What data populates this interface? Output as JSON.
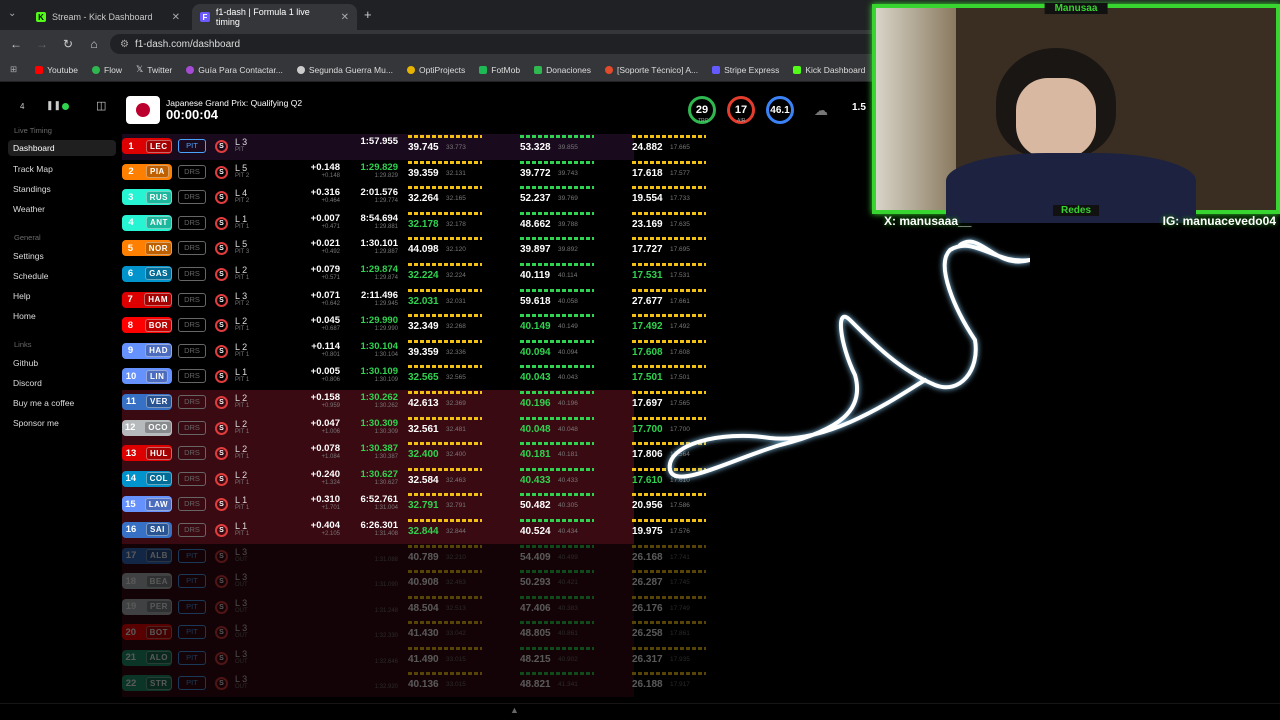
{
  "browser": {
    "tabs": [
      {
        "label": "Stream - Kick Dashboard",
        "favicon": "K"
      },
      {
        "label": "f1-dash | Formula 1 live timing",
        "favicon": "F"
      }
    ],
    "url": "f1-dash.com/dashboard",
    "bookmarks": [
      "Youtube",
      "Flow",
      "Twitter",
      "Guía Para Contactar...",
      "Segunda Guerra Mu...",
      "OptiProjects",
      "FotMob",
      "Donaciones",
      "[Soporte Técnico] A...",
      "Stripe Express",
      "Kick Dashboard"
    ]
  },
  "sidebar": {
    "top_number": "4",
    "section_live": "Live Timing",
    "live_items": [
      "Dashboard",
      "Track Map",
      "Standings",
      "Weather"
    ],
    "section_general": "General",
    "general_items": [
      "Settings",
      "Schedule",
      "Help",
      "Home"
    ],
    "section_links": "Links",
    "link_items": [
      "Github",
      "Discord",
      "Buy me a coffee",
      "Sponsor me"
    ]
  },
  "session": {
    "name": "Japanese Grand Prix: Qualifying Q2",
    "clock": "00:00:04",
    "weather": {
      "track_temp": "29",
      "track_label": "TRC",
      "air_temp": "17",
      "air_label": "AIR",
      "humidity": "46.1",
      "wind": "1.5"
    }
  },
  "drivers": [
    {
      "pos": "1",
      "code": "LEC",
      "color": "#dc0000",
      "pit": "PIT",
      "pit_active": true,
      "lap": "L 3",
      "lap_sub": "PIT",
      "gap": "",
      "gap_sub": "",
      "best": "1:57.955",
      "best_sub": "",
      "s1": "39.745",
      "s1p": "33.773",
      "s2": "53.328",
      "s2p": "39.855",
      "s3": "24.882",
      "s3p": "17.665",
      "bg": "#1a0a1e"
    },
    {
      "pos": "2",
      "code": "PIA",
      "color": "#ff8000",
      "pit": "DRS",
      "pit_active": false,
      "lap": "L 5",
      "lap_sub": "PIT 2",
      "gap": "+0.148",
      "gap_sub": "+0.148",
      "best": "1:29.829",
      "best_sub": "1:29.829",
      "s1": "39.359",
      "s1p": "32.131",
      "s2": "39.772",
      "s2p": "39.743",
      "s3": "17.618",
      "s3p": "17.577",
      "bg": "#000"
    },
    {
      "pos": "3",
      "code": "RUS",
      "color": "#27f4d2",
      "pit": "DRS",
      "pit_active": false,
      "lap": "L 4",
      "lap_sub": "PIT 2",
      "gap": "+0.316",
      "gap_sub": "+0.464",
      "best": "2:01.576",
      "best_sub": "1:29.774",
      "s1": "32.264",
      "s1p": "32.165",
      "s2": "52.237",
      "s2p": "39.769",
      "s3": "19.554",
      "s3p": "17.733",
      "bg": "#000"
    },
    {
      "pos": "4",
      "code": "ANT",
      "color": "#27f4d2",
      "pit": "DRS",
      "pit_active": false,
      "lap": "L 1",
      "lap_sub": "PIT 1",
      "gap": "+0.007",
      "gap_sub": "+0.471",
      "best": "8:54.694",
      "best_sub": "1:29.881",
      "s1": "32.178",
      "s1p": "32.178",
      "s2": "48.662",
      "s2p": "39.788",
      "s3": "23.169",
      "s3p": "17.635",
      "bg": "#000"
    },
    {
      "pos": "5",
      "code": "NOR",
      "color": "#ff8000",
      "pit": "DRS",
      "pit_active": false,
      "lap": "L 5",
      "lap_sub": "PIT 3",
      "gap": "+0.021",
      "gap_sub": "+0.492",
      "best": "1:30.101",
      "best_sub": "1:29.887",
      "s1": "44.098",
      "s1p": "32.120",
      "s2": "39.897",
      "s2p": "39.892",
      "s3": "17.727",
      "s3p": "17.695",
      "bg": "#000"
    },
    {
      "pos": "6",
      "code": "GAS",
      "color": "#0093cc",
      "pit": "DRS",
      "pit_active": false,
      "lap": "L 2",
      "lap_sub": "PIT 1",
      "gap": "+0.079",
      "gap_sub": "+0.571",
      "best": "1:29.874",
      "best_sub": "1:29.874",
      "s1": "32.224",
      "s1p": "32.224",
      "s2": "40.119",
      "s2p": "40.114",
      "s3": "17.531",
      "s3p": "17.531",
      "bg": "#000"
    },
    {
      "pos": "7",
      "code": "HAM",
      "color": "#dc0000",
      "pit": "DRS",
      "pit_active": false,
      "lap": "L 3",
      "lap_sub": "PIT 2",
      "gap": "+0.071",
      "gap_sub": "+0.642",
      "best": "2:11.496",
      "best_sub": "1:29.945",
      "s1": "32.031",
      "s1p": "32.031",
      "s2": "59.618",
      "s2p": "40.058",
      "s3": "27.677",
      "s3p": "17.661",
      "bg": "#000"
    },
    {
      "pos": "8",
      "code": "BOR",
      "color": "#ff0000",
      "pit": "DRS",
      "pit_active": false,
      "lap": "L 2",
      "lap_sub": "PIT 1",
      "gap": "+0.045",
      "gap_sub": "+0.687",
      "best": "1:29.990",
      "best_sub": "1:29.990",
      "s1": "32.349",
      "s1p": "32.268",
      "s2": "40.149",
      "s2p": "40.149",
      "s3": "17.492",
      "s3p": "17.492",
      "bg": "#000"
    },
    {
      "pos": "9",
      "code": "HAD",
      "color": "#6692ff",
      "pit": "DRS",
      "pit_active": false,
      "lap": "L 2",
      "lap_sub": "PIT 1",
      "gap": "+0.114",
      "gap_sub": "+0.801",
      "best": "1:30.104",
      "best_sub": "1:30.104",
      "s1": "39.359",
      "s1p": "32.336",
      "s2": "40.094",
      "s2p": "40.094",
      "s3": "17.608",
      "s3p": "17.608",
      "bg": "#000"
    },
    {
      "pos": "10",
      "code": "LIN",
      "color": "#6692ff",
      "pit": "DRS",
      "pit_active": false,
      "lap": "L 1",
      "lap_sub": "PIT 1",
      "gap": "+0.005",
      "gap_sub": "+0.806",
      "best": "1:30.109",
      "best_sub": "1:30.109",
      "s1": "32.565",
      "s1p": "32.565",
      "s2": "40.043",
      "s2p": "40.043",
      "s3": "17.501",
      "s3p": "17.501",
      "bg": "#000"
    },
    {
      "pos": "11",
      "code": "VER",
      "color": "#3671c6",
      "pit": "DRS",
      "pit_active": false,
      "lap": "L 2",
      "lap_sub": "PIT 1",
      "gap": "+0.158",
      "gap_sub": "+0.959",
      "best": "1:30.262",
      "best_sub": "1:30.262",
      "s1": "42.613",
      "s1p": "32.369",
      "s2": "40.196",
      "s2p": "40.196",
      "s3": "17.697",
      "s3p": "17.565",
      "bg": "#3a0a12"
    },
    {
      "pos": "12",
      "code": "OCO",
      "color": "#b6babd",
      "pit": "DRS",
      "pit_active": false,
      "lap": "L 2",
      "lap_sub": "PIT 1",
      "gap": "+0.047",
      "gap_sub": "+1.006",
      "best": "1:30.309",
      "best_sub": "1:30.309",
      "s1": "32.561",
      "s1p": "32.481",
      "s2": "40.048",
      "s2p": "40.048",
      "s3": "17.700",
      "s3p": "17.700",
      "bg": "#3a0a12"
    },
    {
      "pos": "13",
      "code": "HUL",
      "color": "#dc0000",
      "pit": "DRS",
      "pit_active": false,
      "lap": "L 2",
      "lap_sub": "PIT 1",
      "gap": "+0.078",
      "gap_sub": "+1.084",
      "best": "1:30.387",
      "best_sub": "1:30.387",
      "s1": "32.400",
      "s1p": "32.400",
      "s2": "40.181",
      "s2p": "40.181",
      "s3": "17.806",
      "s3p": "17.564",
      "bg": "#3a0a12"
    },
    {
      "pos": "14",
      "code": "COL",
      "color": "#0093cc",
      "pit": "DRS",
      "pit_active": false,
      "lap": "L 2",
      "lap_sub": "PIT 1",
      "gap": "+0.240",
      "gap_sub": "+1.324",
      "best": "1:30.627",
      "best_sub": "1:30.627",
      "s1": "32.584",
      "s1p": "32.463",
      "s2": "40.433",
      "s2p": "40.433",
      "s3": "17.610",
      "s3p": "17.610",
      "bg": "#3a0a12"
    },
    {
      "pos": "15",
      "code": "LAW",
      "color": "#6692ff",
      "pit": "DRS",
      "pit_active": false,
      "lap": "L 1",
      "lap_sub": "PIT 1",
      "gap": "+0.310",
      "gap_sub": "+1.701",
      "best": "6:52.761",
      "best_sub": "1:31.004",
      "s1": "32.791",
      "s1p": "32.791",
      "s2": "50.482",
      "s2p": "40.305",
      "s3": "20.956",
      "s3p": "17.586",
      "bg": "#3a0a12"
    },
    {
      "pos": "16",
      "code": "SAI",
      "color": "#3671c6",
      "pit": "DRS",
      "pit_active": false,
      "lap": "L 1",
      "lap_sub": "PIT 1",
      "gap": "+0.404",
      "gap_sub": "+2.105",
      "best": "6:26.301",
      "best_sub": "1:31.408",
      "s1": "32.844",
      "s1p": "32.844",
      "s2": "40.524",
      "s2p": "40.434",
      "s3": "19.975",
      "s3p": "17.576",
      "bg": "#3a0a12"
    },
    {
      "pos": "17",
      "code": "ALB",
      "color": "#3671c6",
      "pit": "PIT",
      "pit_active": true,
      "lap": "L 3",
      "lap_sub": "OUT",
      "gap": "",
      "gap_sub": "",
      "best": "",
      "best_sub": "1:31.088",
      "s1": "40.789",
      "s1p": "32.210",
      "s2": "54.409",
      "s2p": "40.499",
      "s3": "26.168",
      "s3p": "17.741",
      "bg": "#3a0a12",
      "faded": true
    },
    {
      "pos": "18",
      "code": "BEA",
      "color": "#b6babd",
      "pit": "PIT",
      "pit_active": true,
      "lap": "L 3",
      "lap_sub": "OUT",
      "gap": "",
      "gap_sub": "",
      "best": "",
      "best_sub": "1:31.090",
      "s1": "40.908",
      "s1p": "32.463",
      "s2": "50.293",
      "s2p": "40.421",
      "s3": "26.287",
      "s3p": "17.745",
      "bg": "#3a0a12",
      "faded": true
    },
    {
      "pos": "19",
      "code": "PER",
      "color": "#b6babd",
      "pit": "PIT",
      "pit_active": true,
      "lap": "L 3",
      "lap_sub": "OUT",
      "gap": "",
      "gap_sub": "",
      "best": "",
      "best_sub": "1:31.248",
      "s1": "48.504",
      "s1p": "32.513",
      "s2": "47.406",
      "s2p": "40.383",
      "s3": "26.176",
      "s3p": "17.749",
      "bg": "#3a0a12",
      "faded": true
    },
    {
      "pos": "20",
      "code": "BOT",
      "color": "#ff0000",
      "pit": "PIT",
      "pit_active": true,
      "lap": "L 3",
      "lap_sub": "OUT",
      "gap": "",
      "gap_sub": "",
      "best": "",
      "best_sub": "1:32.330",
      "s1": "41.430",
      "s1p": "33.042",
      "s2": "48.805",
      "s2p": "40.861",
      "s3": "26.258",
      "s3p": "17.861",
      "bg": "#3a0a12",
      "faded": true
    },
    {
      "pos": "21",
      "code": "ALO",
      "color": "#229971",
      "pit": "PIT",
      "pit_active": true,
      "lap": "L 3",
      "lap_sub": "OUT",
      "gap": "",
      "gap_sub": "",
      "best": "",
      "best_sub": "1:32.646",
      "s1": "41.490",
      "s1p": "33.015",
      "s2": "48.215",
      "s2p": "40.902",
      "s3": "26.317",
      "s3p": "17.935",
      "bg": "#3a0a12",
      "faded": true
    },
    {
      "pos": "22",
      "code": "STR",
      "color": "#229971",
      "pit": "PIT",
      "pit_active": true,
      "lap": "L 3",
      "lap_sub": "OUT",
      "gap": "",
      "gap_sub": "",
      "best": "",
      "best_sub": "1:32.920",
      "s1": "40.136",
      "s1p": "33.015",
      "s2": "48.821",
      "s2p": "41.341",
      "s3": "26.188",
      "s3p": "17.917",
      "bg": "#3a0a12",
      "faded": true
    }
  ],
  "overlay": {
    "webcam_title": "Manusaa",
    "socials_title": "Redes",
    "x_handle": "X: manusaaa__",
    "ig_handle": "IG: manuacevedo04"
  },
  "colors": {
    "accent_green": "#38d430",
    "purple": "#a05cff",
    "timing_green": "#2fd34f",
    "timing_yellow": "#f2c014"
  }
}
